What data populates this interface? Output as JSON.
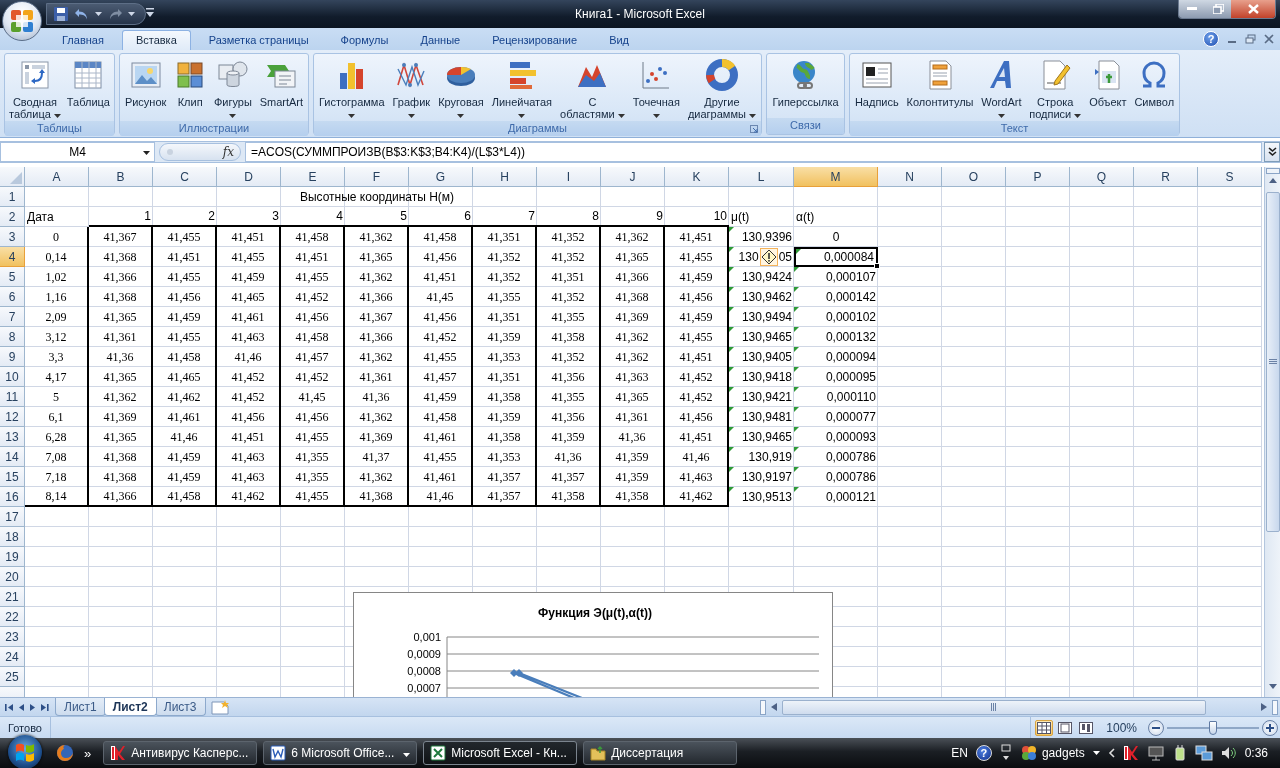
{
  "window": {
    "title": "Книга1 - Microsoft Excel"
  },
  "ribbon": {
    "tabs": [
      {
        "label": "Главная",
        "selected": false
      },
      {
        "label": "Вставка",
        "selected": true
      },
      {
        "label": "Разметка страницы",
        "selected": false
      },
      {
        "label": "Формулы",
        "selected": false
      },
      {
        "label": "Данные",
        "selected": false
      },
      {
        "label": "Рецензирование",
        "selected": false
      },
      {
        "label": "Вид",
        "selected": false
      }
    ],
    "help": "?",
    "groups": [
      {
        "label": "Таблицы",
        "launcher": false,
        "buttons": [
          {
            "lines": [
              "Сводная",
              "таблица"
            ],
            "dropdown": true
          },
          {
            "lines": [
              "Таблица"
            ],
            "dropdown": false
          }
        ]
      },
      {
        "label": "Иллюстрации",
        "launcher": false,
        "buttons": [
          {
            "lines": [
              "Рисунок"
            ],
            "dropdown": false
          },
          {
            "lines": [
              "Клип"
            ],
            "dropdown": false
          },
          {
            "lines": [
              "Фигуры"
            ],
            "dropdown": true
          },
          {
            "lines": [
              "SmartArt"
            ],
            "dropdown": false
          }
        ]
      },
      {
        "label": "Диаграммы",
        "launcher": true,
        "buttons": [
          {
            "lines": [
              "Гистограмма"
            ],
            "dropdown": true
          },
          {
            "lines": [
              "График"
            ],
            "dropdown": true
          },
          {
            "lines": [
              "Круговая"
            ],
            "dropdown": true
          },
          {
            "lines": [
              "Линейчатая"
            ],
            "dropdown": true
          },
          {
            "lines": [
              "С",
              "областями"
            ],
            "dropdown": true
          },
          {
            "lines": [
              "Точечная"
            ],
            "dropdown": true
          },
          {
            "lines": [
              "Другие",
              "диаграммы"
            ],
            "dropdown": true
          }
        ]
      },
      {
        "label": "Связи",
        "launcher": false,
        "buttons": [
          {
            "lines": [
              "Гиперссылка"
            ],
            "dropdown": false
          }
        ]
      },
      {
        "label": "Текст",
        "launcher": false,
        "buttons": [
          {
            "lines": [
              "Надпись"
            ],
            "dropdown": false
          },
          {
            "lines": [
              "Колонтитулы"
            ],
            "dropdown": false
          },
          {
            "lines": [
              "WordArt"
            ],
            "dropdown": true
          },
          {
            "lines": [
              "Строка",
              "подписи"
            ],
            "dropdown": true
          },
          {
            "lines": [
              "Объект"
            ],
            "dropdown": false
          },
          {
            "lines": [
              "Символ"
            ],
            "dropdown": false
          }
        ]
      }
    ]
  },
  "formula_bar": {
    "name_box": "M4",
    "function_label": "fx",
    "formula": "=ACOS(СУММПРОИЗВ(B$3:K$3;B4:K4)/(L$3*L4))"
  },
  "sheet": {
    "columns": [
      {
        "label": "A",
        "selected": false
      },
      {
        "label": "B",
        "selected": false
      },
      {
        "label": "C",
        "selected": false
      },
      {
        "label": "D",
        "selected": false
      },
      {
        "label": "E",
        "selected": false
      },
      {
        "label": "F",
        "selected": false
      },
      {
        "label": "G",
        "selected": false
      },
      {
        "label": "H",
        "selected": false
      },
      {
        "label": "I",
        "selected": false
      },
      {
        "label": "J",
        "selected": false
      },
      {
        "label": "K",
        "selected": false
      },
      {
        "label": "L",
        "selected": false
      },
      {
        "label": "M",
        "selected": true
      },
      {
        "label": "N",
        "selected": false
      },
      {
        "label": "O",
        "selected": false
      },
      {
        "label": "P",
        "selected": false
      },
      {
        "label": "Q",
        "selected": false
      },
      {
        "label": "R",
        "selected": false
      },
      {
        "label": "S",
        "selected": false
      }
    ],
    "rows": [
      {
        "label": "1",
        "selected": false,
        "banner": "Высотные координаты H(м)"
      },
      {
        "label": "2",
        "selected": false,
        "cells": [
          "Дата",
          "1",
          "2",
          "3",
          "4",
          "5",
          "6",
          "7",
          "8",
          "9",
          "10",
          "μ(t)",
          "α(t)"
        ]
      },
      {
        "label": "3",
        "selected": false,
        "cells": [
          "0",
          "41,367",
          "41,455",
          "41,451",
          "41,458",
          "41,362",
          "41,458",
          "41,351",
          "41,352",
          "41,362",
          "41,451",
          {
            "text": "130,9396",
            "flag": true,
            "selected": false
          },
          {
            "text": "0",
            "flag": false,
            "selected": false
          }
        ]
      },
      {
        "label": "4",
        "selected": true,
        "cells": [
          "0,14",
          "41,368",
          "41,451",
          "41,455",
          "41,451",
          "41,365",
          "41,456",
          "41,352",
          "41,352",
          "41,365",
          "41,455",
          {
            "text": "130",
            "text_end": "05",
            "warning": true,
            "flag": true,
            "selected": false
          },
          {
            "text": "0,000084",
            "flag": true,
            "selected": true
          }
        ]
      },
      {
        "label": "5",
        "selected": false,
        "cells": [
          "1,02",
          "41,366",
          "41,455",
          "41,459",
          "41,455",
          "41,362",
          "41,451",
          "41,352",
          "41,351",
          "41,366",
          "41,459",
          {
            "text": "130,9424",
            "flag": true,
            "selected": false
          },
          {
            "text": "0,000107",
            "flag": true,
            "selected": false
          }
        ]
      },
      {
        "label": "6",
        "selected": false,
        "cells": [
          "1,16",
          "41,368",
          "41,456",
          "41,465",
          "41,452",
          "41,366",
          "41,45",
          "41,355",
          "41,352",
          "41,368",
          "41,456",
          {
            "text": "130,9462",
            "flag": true,
            "selected": false
          },
          {
            "text": "0,000142",
            "flag": true,
            "selected": false
          }
        ]
      },
      {
        "label": "7",
        "selected": false,
        "cells": [
          "2,09",
          "41,365",
          "41,459",
          "41,461",
          "41,456",
          "41,367",
          "41,456",
          "41,351",
          "41,355",
          "41,369",
          "41,459",
          {
            "text": "130,9494",
            "flag": true,
            "selected": false
          },
          {
            "text": "0,000102",
            "flag": true,
            "selected": false
          }
        ]
      },
      {
        "label": "8",
        "selected": false,
        "cells": [
          "3,12",
          "41,361",
          "41,455",
          "41,463",
          "41,458",
          "41,366",
          "41,452",
          "41,359",
          "41,358",
          "41,362",
          "41,455",
          {
            "text": "130,9465",
            "flag": true,
            "selected": false
          },
          {
            "text": "0,000132",
            "flag": true,
            "selected": false
          }
        ]
      },
      {
        "label": "9",
        "selected": false,
        "cells": [
          "3,3",
          "41,36",
          "41,458",
          "41,46",
          "41,457",
          "41,362",
          "41,455",
          "41,353",
          "41,352",
          "41,362",
          "41,451",
          {
            "text": "130,9405",
            "flag": true,
            "selected": false
          },
          {
            "text": "0,000094",
            "flag": true,
            "selected": false
          }
        ]
      },
      {
        "label": "10",
        "selected": false,
        "cells": [
          "4,17",
          "41,365",
          "41,465",
          "41,452",
          "41,452",
          "41,361",
          "41,457",
          "41,351",
          "41,356",
          "41,363",
          "41,452",
          {
            "text": "130,9418",
            "flag": true,
            "selected": false
          },
          {
            "text": "0,000095",
            "flag": true,
            "selected": false
          }
        ]
      },
      {
        "label": "11",
        "selected": false,
        "cells": [
          "5",
          "41,362",
          "41,462",
          "41,452",
          "41,45",
          "41,36",
          "41,459",
          "41,358",
          "41,355",
          "41,365",
          "41,452",
          {
            "text": "130,9421",
            "flag": true,
            "selected": false
          },
          {
            "text": "0,000110",
            "flag": true,
            "selected": false
          }
        ]
      },
      {
        "label": "12",
        "selected": false,
        "cells": [
          "6,1",
          "41,369",
          "41,461",
          "41,456",
          "41,456",
          "41,362",
          "41,458",
          "41,359",
          "41,356",
          "41,361",
          "41,456",
          {
            "text": "130,9481",
            "flag": true,
            "selected": false
          },
          {
            "text": "0,000077",
            "flag": true,
            "selected": false
          }
        ]
      },
      {
        "label": "13",
        "selected": false,
        "cells": [
          "6,28",
          "41,365",
          "41,46",
          "41,451",
          "41,455",
          "41,369",
          "41,461",
          "41,358",
          "41,359",
          "41,36",
          "41,451",
          {
            "text": "130,9465",
            "flag": true,
            "selected": false
          },
          {
            "text": "0,000093",
            "flag": true,
            "selected": false
          }
        ]
      },
      {
        "label": "14",
        "selected": false,
        "cells": [
          "7,08",
          "41,368",
          "41,459",
          "41,463",
          "41,355",
          "41,37",
          "41,455",
          "41,353",
          "41,36",
          "41,359",
          "41,46",
          {
            "text": "130,919",
            "flag": true,
            "selected": false
          },
          {
            "text": "0,000786",
            "flag": true,
            "selected": false
          }
        ]
      },
      {
        "label": "15",
        "selected": false,
        "cells": [
          "7,18",
          "41,368",
          "41,459",
          "41,463",
          "41,355",
          "41,362",
          "41,461",
          "41,357",
          "41,357",
          "41,359",
          "41,463",
          {
            "text": "130,9197",
            "flag": true,
            "selected": false
          },
          {
            "text": "0,000786",
            "flag": true,
            "selected": false
          }
        ]
      },
      {
        "label": "16",
        "selected": false,
        "cells": [
          "8,14",
          "41,366",
          "41,458",
          "41,462",
          "41,455",
          "41,368",
          "41,46",
          "41,357",
          "41,358",
          "41,358",
          "41,462",
          {
            "text": "130,9513",
            "flag": true,
            "selected": false
          },
          {
            "text": "0,000121",
            "flag": true,
            "selected": false
          }
        ]
      },
      {
        "label": "17",
        "selected": false
      },
      {
        "label": "18",
        "selected": false
      },
      {
        "label": "19",
        "selected": false
      },
      {
        "label": "20",
        "selected": false
      },
      {
        "label": "21",
        "selected": false
      },
      {
        "label": "22",
        "selected": false
      },
      {
        "label": "23",
        "selected": false
      },
      {
        "label": "24",
        "selected": false
      },
      {
        "label": "25",
        "selected": false
      },
      {
        "selected": false
      }
    ],
    "chart": {
      "title": "Функция Э(μ(t),α(t))",
      "y_axis_labels": [
        "0,001",
        "0,0009",
        "0,0008",
        "0,0007"
      ]
    }
  },
  "sheet_tabs": [
    {
      "label": "Лист1",
      "selected": false
    },
    {
      "label": "Лист2",
      "selected": true
    },
    {
      "label": "Лист3",
      "selected": false
    }
  ],
  "status_bar": {
    "status": "Готово",
    "views": [
      {
        "selected": true
      },
      {
        "selected": false
      },
      {
        "selected": false
      }
    ],
    "zoom_label": "100%",
    "zoom": {
      "level": 0.5
    }
  },
  "taskbar": {
    "more": "»",
    "items": [
      {
        "label": "Антивирус Касперс...",
        "selected": false,
        "dropdown": false
      },
      {
        "label": "6 Microsoft Office...",
        "selected": false,
        "dropdown": true
      },
      {
        "label": "Microsoft Excel - Кн...",
        "selected": true,
        "dropdown": false
      },
      {
        "label": "Диссертация",
        "selected": false,
        "dropdown": false
      }
    ],
    "tray": {
      "language": "EN",
      "help": "?",
      "gadgets": "gadgets",
      "clock": "0:36"
    }
  }
}
